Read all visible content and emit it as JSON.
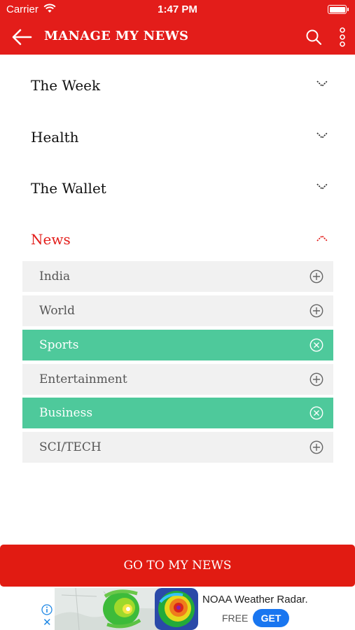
{
  "status_bar": {
    "carrier": "Carrier",
    "time": "1:47 PM"
  },
  "app_bar": {
    "title": "MANAGE MY NEWS"
  },
  "sections": [
    {
      "label": "The Week",
      "expanded": false
    },
    {
      "label": "Health",
      "expanded": false
    },
    {
      "label": "The Wallet",
      "expanded": false
    },
    {
      "label": "News",
      "expanded": true
    }
  ],
  "news_items": [
    {
      "label": "India",
      "selected": false
    },
    {
      "label": "World",
      "selected": false
    },
    {
      "label": "Sports",
      "selected": true
    },
    {
      "label": "Entertainment",
      "selected": false
    },
    {
      "label": "Business",
      "selected": true
    },
    {
      "label": "SCI/TECH",
      "selected": false
    }
  ],
  "go_button": {
    "label": "GO TO MY NEWS"
  },
  "ad": {
    "title": "NOAA Weather Radar.",
    "price": "FREE",
    "cta": "GET",
    "close": "✕"
  },
  "colors": {
    "brand_red": "#e31d1a",
    "selected_green": "#4ec99b",
    "row_gray": "#f1f1f1",
    "ad_blue": "#1976f0"
  }
}
